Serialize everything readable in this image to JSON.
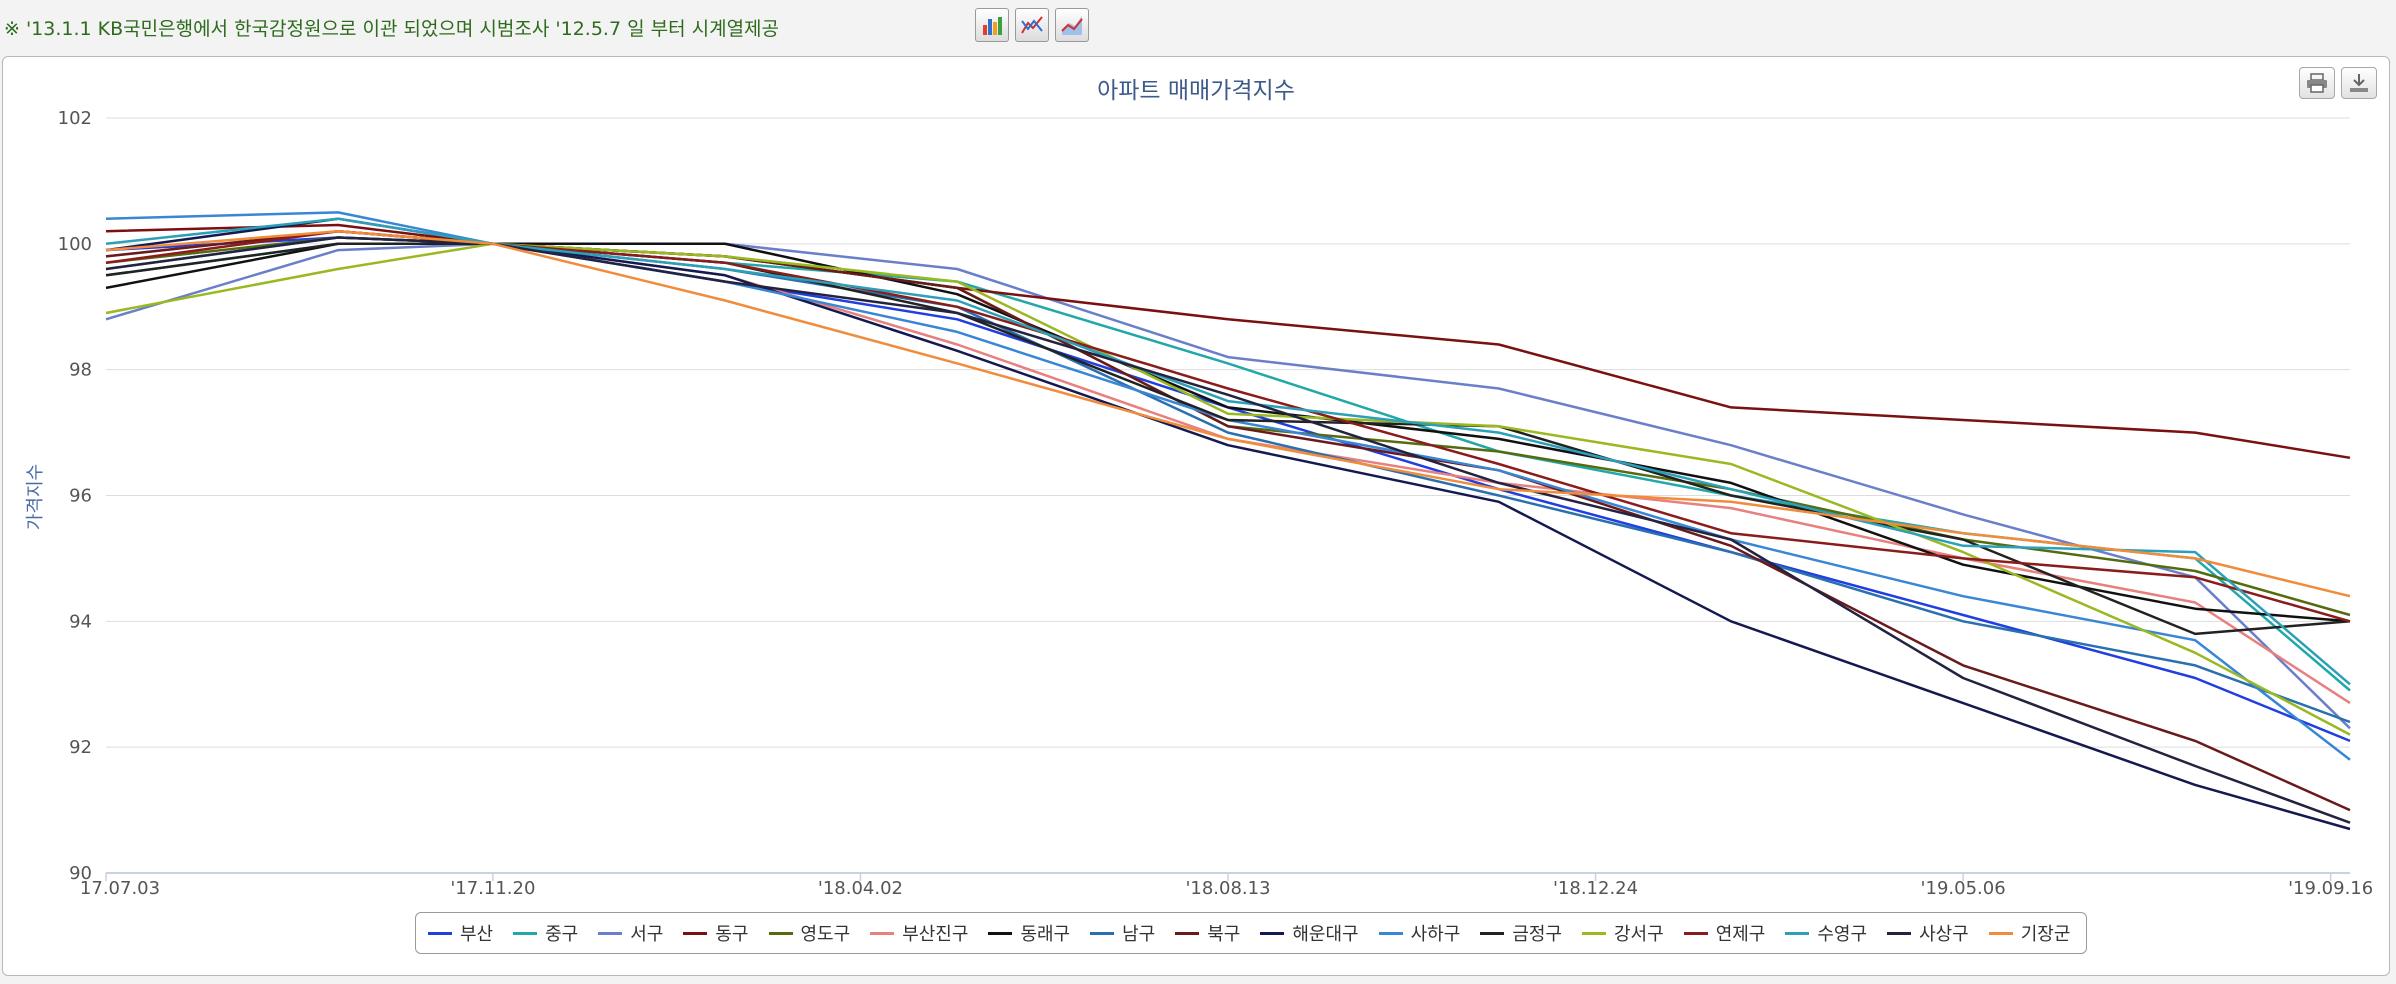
{
  "notice": "※ '13.1.1 KB국민은행에서 한국감정원으로 이관 되었으며 시범조사 '12.5.7 일 부터 시계열제공",
  "toolbar": {
    "buttons": [
      {
        "icon": "bar-chart-icon"
      },
      {
        "icon": "line-chart-icon"
      },
      {
        "icon": "area-chart-icon"
      }
    ]
  },
  "panel_buttons": [
    {
      "icon": "print-icon"
    },
    {
      "icon": "download-icon"
    }
  ],
  "chart_data": {
    "type": "line",
    "title": "아파트 매매가격지수",
    "xlabel": "",
    "ylabel": "가격지수",
    "ylim": [
      90,
      102
    ],
    "yticks": [
      90,
      92,
      94,
      96,
      98,
      100,
      102
    ],
    "xlim": [
      "2017-07-03",
      "2019-09-23"
    ],
    "xticks": [
      {
        "date": "2017-07-03",
        "label": "17.07.03"
      },
      {
        "date": "2017-11-20",
        "label": "'17.11.20"
      },
      {
        "date": "2018-04-02",
        "label": "'18.04.02"
      },
      {
        "date": "2018-08-13",
        "label": "'18.08.13"
      },
      {
        "date": "2018-12-24",
        "label": "'18.12.24"
      },
      {
        "date": "2019-05-06",
        "label": "'19.05.06"
      },
      {
        "date": "2019-09-16",
        "label": "'19.09.16"
      }
    ],
    "grid": true,
    "legend_position": "bottom",
    "x_knots": [
      "2017-07-03",
      "2017-09-25",
      "2017-11-20",
      "2018-02-12",
      "2018-05-07",
      "2018-08-13",
      "2018-11-19",
      "2019-02-11",
      "2019-05-06",
      "2019-07-29",
      "2019-09-23"
    ],
    "series": [
      {
        "name": "부산",
        "color": "#1f3fe0",
        "values": [
          99.9,
          100.1,
          100.0,
          99.4,
          98.8,
          97.4,
          96.1,
          95.1,
          94.1,
          93.1,
          92.1
        ]
      },
      {
        "name": "중구",
        "color": "#22a8a8",
        "values": [
          99.5,
          100.0,
          100.0,
          99.7,
          99.4,
          98.1,
          96.7,
          96.0,
          95.4,
          95.0,
          92.9
        ]
      },
      {
        "name": "서구",
        "color": "#6a7fc9",
        "values": [
          98.8,
          99.9,
          100.0,
          100.0,
          99.6,
          98.2,
          97.7,
          96.8,
          95.7,
          94.7,
          92.3
        ]
      },
      {
        "name": "동구",
        "color": "#7a1010",
        "values": [
          100.2,
          100.3,
          100.0,
          99.8,
          99.3,
          98.8,
          98.4,
          97.4,
          97.2,
          97.0,
          96.6
        ]
      },
      {
        "name": "영도구",
        "color": "#556b10",
        "values": [
          99.7,
          100.1,
          100.0,
          99.8,
          99.3,
          97.1,
          96.7,
          96.1,
          95.3,
          94.8,
          94.1
        ]
      },
      {
        "name": "부산진구",
        "color": "#e88080",
        "values": [
          99.8,
          100.2,
          100.0,
          99.5,
          98.4,
          96.9,
          96.2,
          95.8,
          95.0,
          94.3,
          92.7
        ]
      },
      {
        "name": "동래구",
        "color": "#111111",
        "values": [
          99.3,
          100.0,
          100.0,
          100.0,
          99.2,
          97.4,
          96.9,
          96.2,
          94.9,
          94.2,
          94.0
        ]
      },
      {
        "name": "남구",
        "color": "#2a6fb0",
        "values": [
          99.6,
          100.1,
          100.0,
          99.6,
          99.0,
          97.0,
          96.0,
          95.1,
          94.0,
          93.3,
          92.4
        ]
      },
      {
        "name": "북구",
        "color": "#6a1a1a",
        "values": [
          99.8,
          100.2,
          100.0,
          99.8,
          99.3,
          97.1,
          96.4,
          95.2,
          93.3,
          92.1,
          91.0
        ]
      },
      {
        "name": "해운대구",
        "color": "#141a50",
        "values": [
          99.9,
          100.4,
          100.0,
          99.5,
          98.3,
          96.8,
          95.9,
          94.0,
          92.7,
          91.4,
          90.7
        ]
      },
      {
        "name": "사하구",
        "color": "#3a86d6",
        "values": [
          100.4,
          100.5,
          100.0,
          99.4,
          98.6,
          97.2,
          96.4,
          95.3,
          94.4,
          93.7,
          91.8
        ]
      },
      {
        "name": "금정구",
        "color": "#222222",
        "values": [
          99.5,
          100.0,
          100.0,
          99.7,
          98.9,
          97.2,
          97.1,
          96.0,
          95.3,
          93.8,
          94.0
        ]
      },
      {
        "name": "강서구",
        "color": "#9ab820",
        "values": [
          98.9,
          99.6,
          100.0,
          99.8,
          99.4,
          97.3,
          97.1,
          96.5,
          95.1,
          93.5,
          92.2
        ]
      },
      {
        "name": "연제구",
        "color": "#8b1c1c",
        "values": [
          99.7,
          100.2,
          100.0,
          99.7,
          99.0,
          97.7,
          96.5,
          95.4,
          95.0,
          94.7,
          94.0
        ]
      },
      {
        "name": "수영구",
        "color": "#2ba0b8",
        "values": [
          100.0,
          100.4,
          100.0,
          99.6,
          99.1,
          97.5,
          97.0,
          96.1,
          95.2,
          95.1,
          93.0
        ]
      },
      {
        "name": "사상구",
        "color": "#232340",
        "values": [
          99.6,
          100.1,
          100.0,
          99.4,
          98.9,
          97.6,
          96.2,
          95.3,
          93.1,
          91.7,
          90.8
        ]
      },
      {
        "name": "기장군",
        "color": "#f08c3c",
        "values": [
          99.9,
          100.2,
          100.0,
          99.1,
          98.1,
          96.9,
          96.1,
          95.9,
          95.4,
          95.0,
          94.4
        ]
      }
    ]
  }
}
